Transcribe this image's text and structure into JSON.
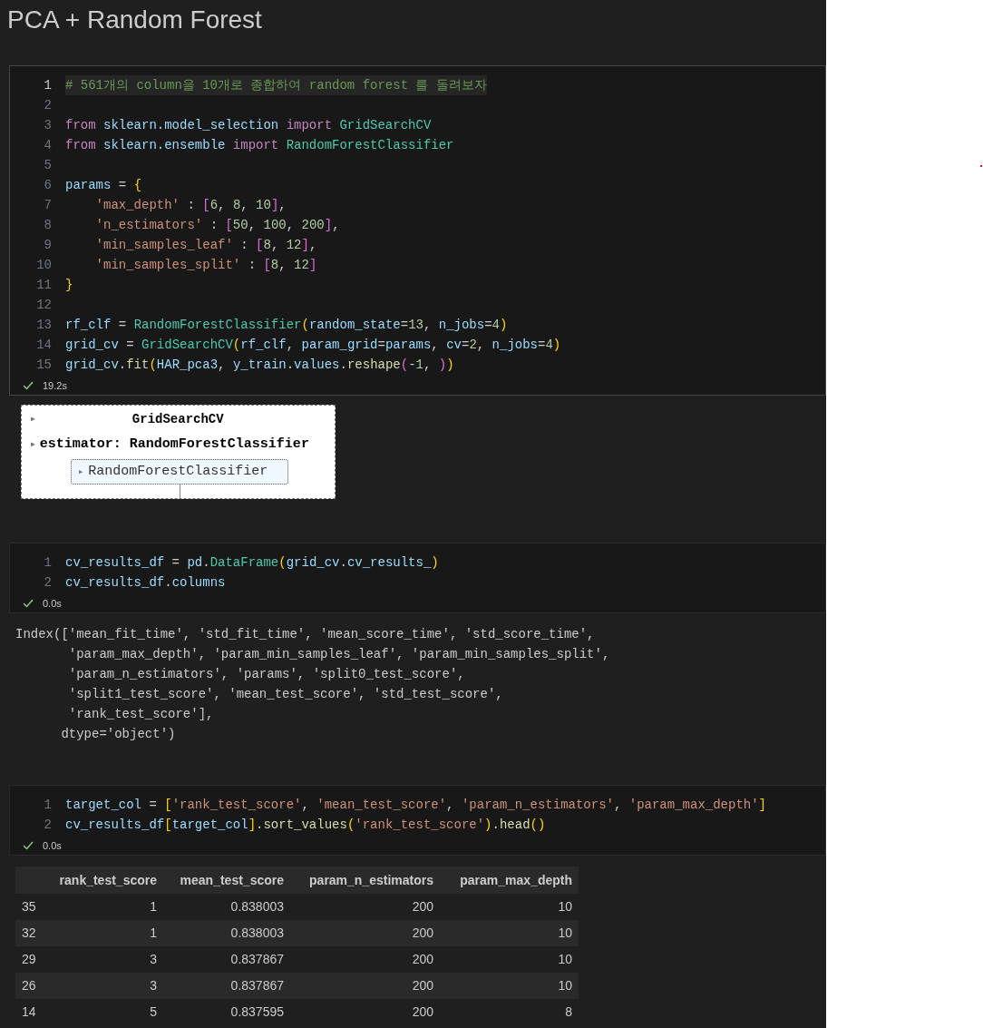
{
  "title": "PCA + Random Forest",
  "cells": [
    {
      "focused": true,
      "duration": "19.2s",
      "lines": [
        {
          "n": "1",
          "active": true,
          "tokens": [
            {
              "kind": "comment",
              "text": "# 561개의 column을 10개로 종합하여 random forest 를 돌려보자"
            }
          ]
        },
        {
          "n": "2",
          "active": false
        },
        {
          "n": "3",
          "active": false,
          "tokens": [
            {
              "kind": "kw",
              "text": "from"
            },
            {
              "kind": "var",
              "text": " sklearn.model_selection"
            },
            {
              "kind": "kw",
              "text": " import"
            },
            {
              "kind": "cls",
              "text": " GridSearchCV"
            }
          ]
        },
        {
          "n": "4",
          "active": false,
          "tokens": [
            {
              "kind": "kw",
              "text": "from"
            },
            {
              "kind": "var",
              "text": " sklearn.ensemble"
            },
            {
              "kind": "kw",
              "text": " import"
            },
            {
              "kind": "cls",
              "text": " RandomForestClassifier"
            }
          ]
        },
        {
          "n": "5",
          "active": false
        },
        {
          "n": "6",
          "active": false,
          "tokens": [
            {
              "kind": "var",
              "text": "params"
            },
            {
              "kind": "op",
              "text": " = "
            },
            {
              "kind": "b1",
              "text": "{"
            }
          ]
        },
        {
          "n": "7",
          "active": false,
          "tokens": [
            {
              "kind": "str",
              "text": "    'max_depth'"
            },
            {
              "kind": "op",
              "text": " : "
            },
            {
              "kind": "b2",
              "text": "["
            },
            {
              "kind": "num",
              "text": "6"
            },
            {
              "kind": "op",
              "text": ", "
            },
            {
              "kind": "num",
              "text": "8"
            },
            {
              "kind": "op",
              "text": ", "
            },
            {
              "kind": "num",
              "text": "10"
            },
            {
              "kind": "b2",
              "text": "]"
            },
            {
              "kind": "op",
              "text": ","
            }
          ]
        },
        {
          "n": "8",
          "active": false,
          "tokens": [
            {
              "kind": "str",
              "text": "    'n_estimators'"
            },
            {
              "kind": "op",
              "text": " : "
            },
            {
              "kind": "b2",
              "text": "["
            },
            {
              "kind": "num",
              "text": "50"
            },
            {
              "kind": "op",
              "text": ", "
            },
            {
              "kind": "num",
              "text": "100"
            },
            {
              "kind": "op",
              "text": ", "
            },
            {
              "kind": "num",
              "text": "200"
            },
            {
              "kind": "b2",
              "text": "]"
            },
            {
              "kind": "op",
              "text": ","
            }
          ]
        },
        {
          "n": "9",
          "active": false,
          "tokens": [
            {
              "kind": "str",
              "text": "    'min_samples_leaf'"
            },
            {
              "kind": "op",
              "text": " : "
            },
            {
              "kind": "b2",
              "text": "["
            },
            {
              "kind": "num",
              "text": "8"
            },
            {
              "kind": "op",
              "text": ", "
            },
            {
              "kind": "num",
              "text": "12"
            },
            {
              "kind": "b2",
              "text": "]"
            },
            {
              "kind": "op",
              "text": ","
            }
          ]
        },
        {
          "n": "10",
          "active": false,
          "tokens": [
            {
              "kind": "str",
              "text": "    'min_samples_split'"
            },
            {
              "kind": "op",
              "text": " : "
            },
            {
              "kind": "b2",
              "text": "["
            },
            {
              "kind": "num",
              "text": "8"
            },
            {
              "kind": "op",
              "text": ", "
            },
            {
              "kind": "num",
              "text": "12"
            },
            {
              "kind": "b2",
              "text": "]"
            }
          ]
        },
        {
          "n": "11",
          "active": false,
          "tokens": [
            {
              "kind": "b1",
              "text": "}"
            }
          ]
        },
        {
          "n": "12",
          "active": false
        },
        {
          "n": "13",
          "active": false,
          "tokens": [
            {
              "kind": "var",
              "text": "rf_clf"
            },
            {
              "kind": "op",
              "text": " = "
            },
            {
              "kind": "cls",
              "text": "RandomForestClassifier"
            },
            {
              "kind": "b1",
              "text": "("
            },
            {
              "kind": "var",
              "text": "random_state"
            },
            {
              "kind": "op",
              "text": "="
            },
            {
              "kind": "num",
              "text": "13"
            },
            {
              "kind": "op",
              "text": ", "
            },
            {
              "kind": "var",
              "text": "n_jobs"
            },
            {
              "kind": "op",
              "text": "="
            },
            {
              "kind": "num",
              "text": "4"
            },
            {
              "kind": "b1",
              "text": ")"
            }
          ]
        },
        {
          "n": "14",
          "active": false,
          "tokens": [
            {
              "kind": "var",
              "text": "grid_cv"
            },
            {
              "kind": "op",
              "text": " = "
            },
            {
              "kind": "cls",
              "text": "GridSearchCV"
            },
            {
              "kind": "b1",
              "text": "("
            },
            {
              "kind": "var",
              "text": "rf_clf"
            },
            {
              "kind": "op",
              "text": ", "
            },
            {
              "kind": "var",
              "text": "param_grid"
            },
            {
              "kind": "op",
              "text": "="
            },
            {
              "kind": "var",
              "text": "params"
            },
            {
              "kind": "op",
              "text": ", "
            },
            {
              "kind": "var",
              "text": "cv"
            },
            {
              "kind": "op",
              "text": "="
            },
            {
              "kind": "num",
              "text": "2"
            },
            {
              "kind": "op",
              "text": ", "
            },
            {
              "kind": "var",
              "text": "n_jobs"
            },
            {
              "kind": "op",
              "text": "="
            },
            {
              "kind": "num",
              "text": "4"
            },
            {
              "kind": "b1",
              "text": ")"
            }
          ]
        },
        {
          "n": "15",
          "active": false,
          "tokens": [
            {
              "kind": "var",
              "text": "grid_cv"
            },
            {
              "kind": "op",
              "text": "."
            },
            {
              "kind": "fn",
              "text": "fit"
            },
            {
              "kind": "b1",
              "text": "("
            },
            {
              "kind": "var",
              "text": "HAR_pca3"
            },
            {
              "kind": "op",
              "text": ", "
            },
            {
              "kind": "var",
              "text": "y_train"
            },
            {
              "kind": "op",
              "text": "."
            },
            {
              "kind": "var",
              "text": "values"
            },
            {
              "kind": "op",
              "text": "."
            },
            {
              "kind": "fn",
              "text": "reshape"
            },
            {
              "kind": "b2",
              "text": "("
            },
            {
              "kind": "op",
              "text": "-"
            },
            {
              "kind": "num",
              "text": "1"
            },
            {
              "kind": "op",
              "text": ", "
            },
            {
              "kind": "b2",
              "text": ")"
            },
            {
              "kind": "b1",
              "text": ")"
            }
          ]
        }
      ],
      "output": {
        "kind": "estimator",
        "toggle": "▶",
        "title": "GridSearchCV",
        "estimator_toggle": "▶",
        "estimator": "estimator: RandomForestClassifier",
        "inner_toggle": "▶",
        "inner": "RandomForestClassifier"
      }
    },
    {
      "focused": false,
      "duration": "0.0s",
      "lines": [
        {
          "n": "1",
          "active": false,
          "tokens": [
            {
              "kind": "var",
              "text": "cv_results_df"
            },
            {
              "kind": "op",
              "text": " = "
            },
            {
              "kind": "var",
              "text": "pd"
            },
            {
              "kind": "op",
              "text": "."
            },
            {
              "kind": "cls",
              "text": "DataFrame"
            },
            {
              "kind": "b1",
              "text": "("
            },
            {
              "kind": "var",
              "text": "grid_cv"
            },
            {
              "kind": "op",
              "text": "."
            },
            {
              "kind": "var",
              "text": "cv_results_"
            },
            {
              "kind": "b1",
              "text": ")"
            }
          ]
        },
        {
          "n": "2",
          "active": false,
          "tokens": [
            {
              "kind": "var",
              "text": "cv_results_df"
            },
            {
              "kind": "op",
              "text": "."
            },
            {
              "kind": "var",
              "text": "columns"
            }
          ]
        }
      ],
      "output": {
        "kind": "text",
        "lines": [
          "Index(['mean_fit_time', 'std_fit_time', 'mean_score_time', 'std_score_time',",
          "       'param_max_depth', 'param_min_samples_leaf', 'param_min_samples_split',",
          "       'param_n_estimators', 'params', 'split0_test_score',",
          "       'split1_test_score', 'mean_test_score', 'std_test_score',",
          "       'rank_test_score'],",
          "      dtype='object')"
        ]
      }
    },
    {
      "focused": false,
      "duration": "0.0s",
      "lines": [
        {
          "n": "1",
          "active": false,
          "tokens": [
            {
              "kind": "var",
              "text": "target_col"
            },
            {
              "kind": "op",
              "text": " = "
            },
            {
              "kind": "b1",
              "text": "["
            },
            {
              "kind": "str",
              "text": "'rank_test_score'"
            },
            {
              "kind": "op",
              "text": ", "
            },
            {
              "kind": "str",
              "text": "'mean_test_score'"
            },
            {
              "kind": "op",
              "text": ", "
            },
            {
              "kind": "str",
              "text": "'param_n_estimators'"
            },
            {
              "kind": "op",
              "text": ", "
            },
            {
              "kind": "str",
              "text": "'param_max_depth'"
            },
            {
              "kind": "b1",
              "text": "]"
            }
          ]
        },
        {
          "n": "2",
          "active": false,
          "tokens": [
            {
              "kind": "var",
              "text": "cv_results_df"
            },
            {
              "kind": "b1",
              "text": "["
            },
            {
              "kind": "var",
              "text": "target_col"
            },
            {
              "kind": "b1",
              "text": "]"
            },
            {
              "kind": "op",
              "text": "."
            },
            {
              "kind": "fn",
              "text": "sort_values"
            },
            {
              "kind": "b1",
              "text": "("
            },
            {
              "kind": "str",
              "text": "'rank_test_score'"
            },
            {
              "kind": "b1",
              "text": ")"
            },
            {
              "kind": "op",
              "text": "."
            },
            {
              "kind": "fn",
              "text": "head"
            },
            {
              "kind": "b1",
              "text": "("
            },
            {
              "kind": "b1",
              "text": ")"
            }
          ]
        }
      ],
      "output": {
        "kind": "table",
        "columns": [
          "",
          "rank_test_score",
          "mean_test_score",
          "param_n_estimators",
          "param_max_depth"
        ],
        "rows": [
          [
            "35",
            "1",
            "0.838003",
            "200",
            "10"
          ],
          [
            "32",
            "1",
            "0.838003",
            "200",
            "10"
          ],
          [
            "29",
            "3",
            "0.837867",
            "200",
            "10"
          ],
          [
            "26",
            "3",
            "0.837867",
            "200",
            "10"
          ],
          [
            "14",
            "5",
            "0.837595",
            "200",
            "8"
          ]
        ]
      }
    }
  ]
}
